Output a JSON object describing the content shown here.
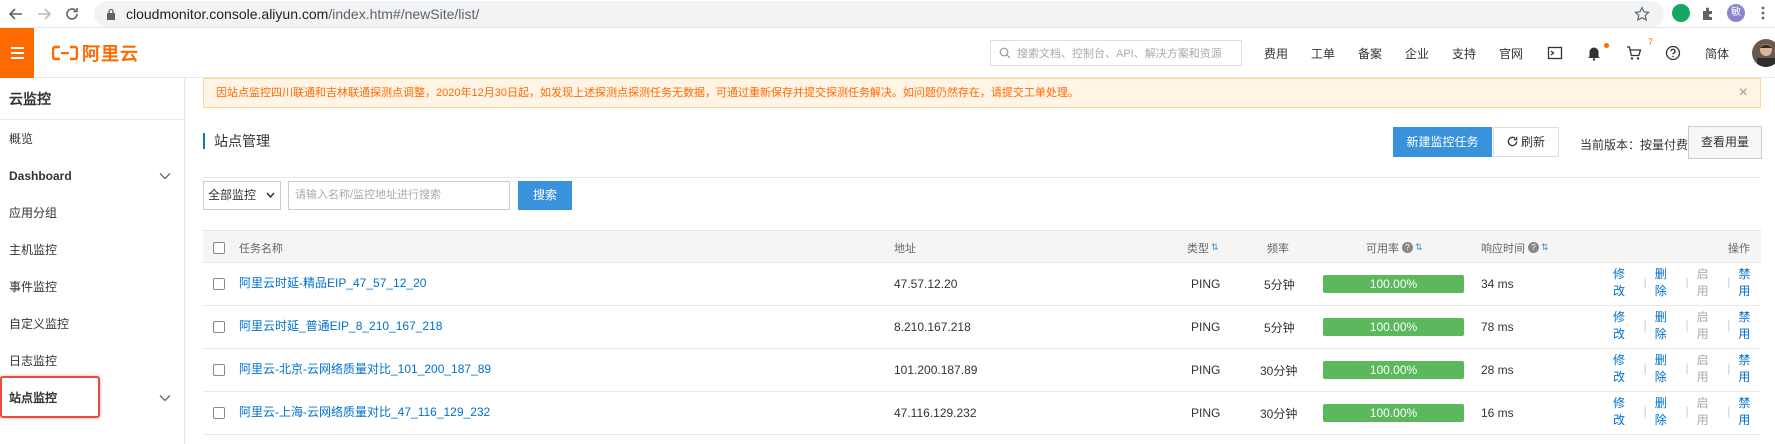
{
  "browser": {
    "url_host": "cloudmonitor.console.aliyun.com",
    "url_path": "/index.htm#/newSite/list/",
    "profile_initial": "敏"
  },
  "header": {
    "logo_text": "阿里云",
    "search_placeholder": "搜索文档、控制台、API、解决方案和资源",
    "nav": [
      "费用",
      "工单",
      "备案",
      "企业",
      "支持",
      "官网"
    ],
    "cart_count": "7",
    "language": "简体",
    "brand_color": "#ff6a00"
  },
  "sidebar": {
    "title": "云监控",
    "items": [
      {
        "label": "概览"
      },
      {
        "label": "Dashboard"
      },
      {
        "label": "应用分组"
      },
      {
        "label": "主机监控"
      },
      {
        "label": "事件监控"
      },
      {
        "label": "自定义监控"
      },
      {
        "label": "日志监控"
      },
      {
        "label": "站点监控"
      }
    ]
  },
  "notice": {
    "text": "因站点监控四川联通和吉林联通探测点调整，2020年12月30日起，如发现上述探测点探测任务无数据，可通过重新保存并提交探测任务解决。如问题仍然存在，请提交工单处理。",
    "close": "×"
  },
  "page": {
    "title": "站点管理",
    "new_task_label": "新建监控任务",
    "refresh_label": "刷新",
    "version_text": "当前版本：按量付费",
    "view_usage_label": "查看用量"
  },
  "filter": {
    "select_value": "全部监控",
    "search_placeholder": "请输入名称/监控地址进行搜索",
    "search_button": "搜索"
  },
  "table": {
    "columns": {
      "name": "任务名称",
      "address": "地址",
      "type": "类型",
      "frequency": "频率",
      "availability": "可用率",
      "response_time": "响应时间",
      "actions": "操作"
    },
    "actions": [
      "修改",
      "删除",
      "启用",
      "禁用"
    ],
    "rows": [
      {
        "name": "阿里云时延-精品EIP_47_57_12_20",
        "address": "47.57.12.20",
        "type": "PING",
        "frequency": "5分钟",
        "availability": "100.00%",
        "response_time": "34 ms"
      },
      {
        "name": "阿里云时延_普通EIP_8_210_167_218",
        "address": "8.210.167.218",
        "type": "PING",
        "frequency": "5分钟",
        "availability": "100.00%",
        "response_time": "78 ms"
      },
      {
        "name": "阿里云-北京-云网络质量对比_101_200_187_89",
        "address": "101.200.187.89",
        "type": "PING",
        "frequency": "30分钟",
        "availability": "100.00%",
        "response_time": "28 ms"
      },
      {
        "name": "阿里云-上海-云网络质量对比_47_116_129_232",
        "address": "47.116.129.232",
        "type": "PING",
        "frequency": "30分钟",
        "availability": "100.00%",
        "response_time": "16 ms"
      }
    ]
  }
}
